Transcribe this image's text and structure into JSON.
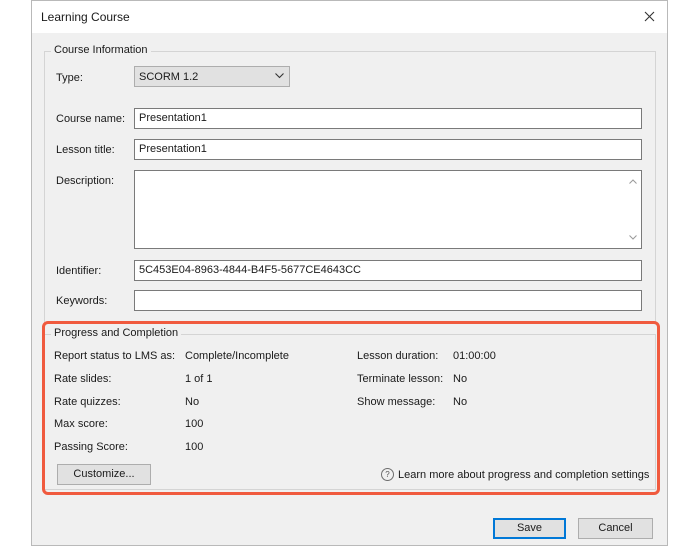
{
  "dialog": {
    "title": "Learning Course"
  },
  "course_info": {
    "legend": "Course Information",
    "type_label": "Type:",
    "type_value": "SCORM 1.2",
    "course_name_label": "Course name:",
    "course_name_value": "Presentation1",
    "lesson_title_label": "Lesson title:",
    "lesson_title_value": "Presentation1",
    "description_label": "Description:",
    "description_value": "",
    "identifier_label": "Identifier:",
    "identifier_value": "5C453E04-8963-4844-B4F5-5677CE4643CC",
    "keywords_label": "Keywords:",
    "keywords_value": ""
  },
  "progress": {
    "legend": "Progress and Completion",
    "report_status_label": "Report status to LMS as:",
    "report_status_value": "Complete/Incomplete",
    "rate_slides_label": "Rate slides:",
    "rate_slides_value": "1 of 1",
    "rate_quizzes_label": "Rate quizzes:",
    "rate_quizzes_value": "No",
    "max_score_label": "Max score:",
    "max_score_value": "100",
    "passing_score_label": "Passing Score:",
    "passing_score_value": "100",
    "lesson_duration_label": "Lesson duration:",
    "lesson_duration_value": "01:00:00",
    "terminate_lesson_label": "Terminate lesson:",
    "terminate_lesson_value": "No",
    "show_message_label": "Show message:",
    "show_message_value": "No",
    "customize_label": "Customize...",
    "help_text": "Learn more about progress and completion settings",
    "highlight_color": "#f05a3e"
  },
  "footer": {
    "save_label": "Save",
    "cancel_label": "Cancel"
  }
}
